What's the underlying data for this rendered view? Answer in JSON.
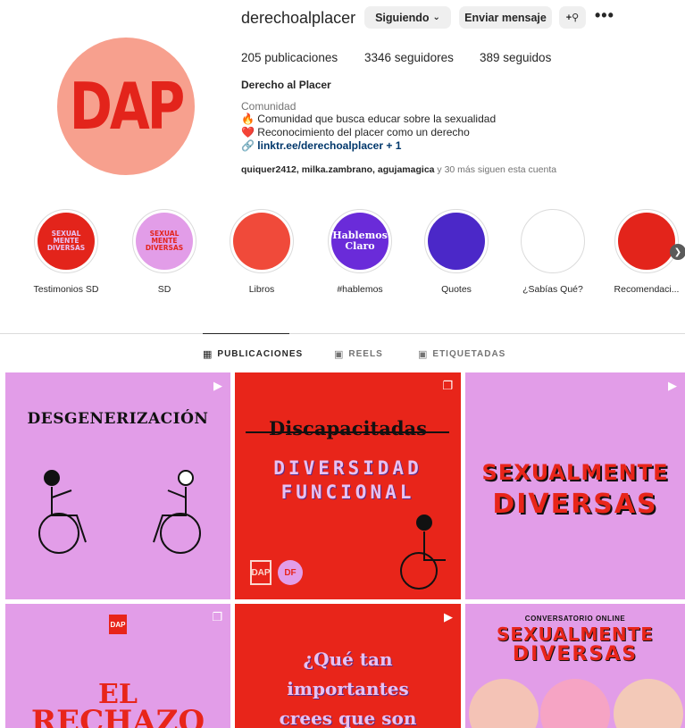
{
  "profile": {
    "username": "derechoalplacer",
    "avatar_text": "DAP",
    "following_label": "Siguiendo",
    "message_label": "Enviar mensaje",
    "posts": "205 publicaciones",
    "followers": "3346 seguidores",
    "following": "389 seguidos",
    "full_name": "Derecho al Placer",
    "category": "Comunidad",
    "bio_line1": "🔥 Comunidad que busca educar sobre la sexualidad",
    "bio_line2": "❤️ Reconocimiento del placer como un derecho",
    "link": "🔗 linktr.ee/derechoalplacer + 1",
    "followed_by_names": "quiquer2412, milka.zambrano, agujamagica",
    "followed_by_rest": " y 30 más siguen esta cuenta"
  },
  "highlights": [
    {
      "label": "Testimonios SD",
      "inner": "SEXUAL MENTE DIVERSAS",
      "color": "#e3241b"
    },
    {
      "label": "SD",
      "inner": "SEXUAL MENTE DIVERSAS",
      "color": "#e29de8"
    },
    {
      "label": "Libros",
      "inner": "",
      "color": "#f04a3a"
    },
    {
      "label": "#hablemos",
      "inner": "Hablemos Claro",
      "color": "#6a2bd9"
    },
    {
      "label": "Quotes",
      "inner": "",
      "color": "#4b28c8"
    },
    {
      "label": "¿Sabías Qué?",
      "inner": "",
      "color": "#ffffff"
    },
    {
      "label": "Recomendaci...",
      "inner": "",
      "color": "#e3241b"
    }
  ],
  "tabs": {
    "posts": "PUBLICACIONES",
    "reels": "REELS",
    "tagged": "ETIQUETADAS"
  },
  "grid": {
    "p1_title": "DESGENERIZACIÓN",
    "p2_title": "Discapacitadas",
    "p2_sub1": "DIVERSIDAD",
    "p2_sub2": "FUNCIONAL",
    "p2_logo": "DAP",
    "p2_logo2": "DF",
    "p3_t1": "SEXUALMENTE",
    "p3_t2": "DIVERSAS",
    "p4_logo": "DAP",
    "p4_t1": "EL",
    "p4_t2": "RECHAZO",
    "p5_t1": "¿Qué tan",
    "p5_t2": "importantes",
    "p5_t3": "crees que son",
    "p6_top": "CONVERSATORIO ONLINE",
    "p6_t1": "SEXUALMENTE",
    "p6_t2": "DIVERSAS"
  },
  "colors": {
    "brand_red": "#e8251a",
    "brand_pink": "#e29de8",
    "avatar_bg": "#f7a08e"
  }
}
